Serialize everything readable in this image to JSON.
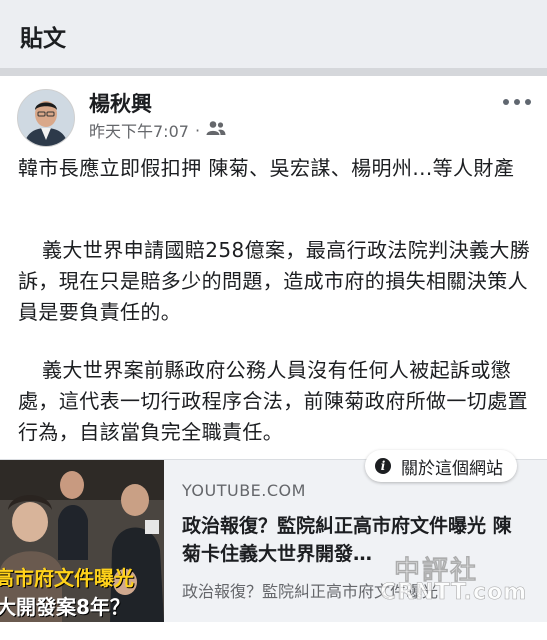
{
  "header": {
    "title": "貼文"
  },
  "post": {
    "author": "楊秋興",
    "timestamp": "昨天下午7:07",
    "separator": "·",
    "audience_icon": "friends-icon",
    "more_icon": "more-icon",
    "paragraphs": [
      "韓市長應立即假扣押 陳菊、吳宏謀、楊明州...等人財產",
      "義大世界申請國賠258億案，最高行政法院判決義大勝訴，現在只是賠多少的問題，造成市府的損失相關決策人員是要負責任的。",
      "義大世界案前縣政府公務人員沒有任何人被起訴或懲處，這代表一切行政程序合法，前陳菊政府所做一切處置行為，自該當負完全職責任。"
    ]
  },
  "link_preview": {
    "about_label": "關於這個網站",
    "about_icon": "info-icon",
    "domain": "YOUTUBE.COM",
    "title": "政治報復？監院糾正高市府文件曝光 陳菊卡住義大世界開發…",
    "description": "政治報復？監院糾正高市府文件曝光",
    "thumbnail_caption_1": "高市府文件曝光",
    "thumbnail_caption_2": "大開發案8年？"
  },
  "watermark": {
    "chinese": "中評社",
    "english": "CRNTT.com"
  }
}
